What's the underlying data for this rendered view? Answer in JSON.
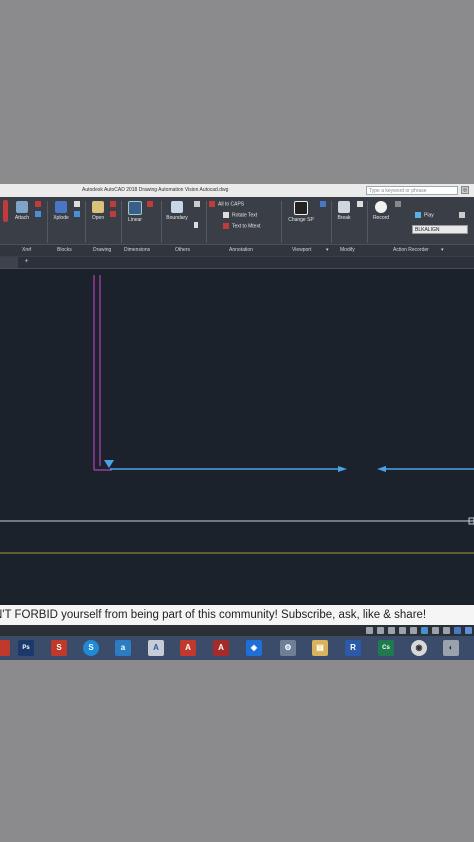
{
  "window": {
    "title": "Autodesk AutoCAD 2018   Drawing Automation Vision Autocad.dwg",
    "search_placeholder": "Type a keyword or phrase"
  },
  "ribbon": {
    "tools": {
      "attach": "Attach",
      "xplode": "Xplode",
      "open": "Open",
      "linear": "Linear",
      "boundary": "Boundary",
      "change_sp": "Change SP",
      "break": "Break",
      "record": "Record",
      "play": "Play"
    },
    "annotation_items": [
      "All to CAPS",
      "Rotate Text",
      "Text to Mtext"
    ],
    "action_dropdown": "BLKALIGN",
    "panels": [
      "Xref",
      "Blocks",
      "Drawing",
      "Dimensions",
      "Others",
      "Annotation",
      "Viewport",
      "Modify",
      "Action Recorder"
    ]
  },
  "banner": {
    "text": "N'T FORBID yourself from being part of this community! Subscribe, ask, like & share!"
  },
  "taskbar": {
    "apps": [
      {
        "name": "photoshop",
        "label": "Ps",
        "color": "#1b3a6b"
      },
      {
        "name": "sketchup",
        "label": "S",
        "color": "#c0392b"
      },
      {
        "name": "skype",
        "label": "S",
        "color": "#1f8ad6"
      },
      {
        "name": "autocad-app",
        "label": "a",
        "color": "#2b7cc0"
      },
      {
        "name": "autocad-lt",
        "label": "A",
        "color": "#c7ccd6"
      },
      {
        "name": "autocad-red",
        "label": "A",
        "color": "#c0392b"
      },
      {
        "name": "acrobat",
        "label": "A",
        "color": "#a52a2a"
      },
      {
        "name": "dropbox",
        "label": "◆",
        "color": "#1f6fd6"
      },
      {
        "name": "network",
        "label": "⚙",
        "color": "#6f7f95"
      },
      {
        "name": "file-explorer",
        "label": "▤",
        "color": "#d9b35c"
      },
      {
        "name": "revit",
        "label": "R",
        "color": "#2a5aa8"
      },
      {
        "name": "camtasia",
        "label": "Cs",
        "color": "#1f7a4d"
      },
      {
        "name": "chrome",
        "label": "◉",
        "color": "#d8d8d8"
      },
      {
        "name": "disk",
        "label": "◐",
        "color": "#9aa3ad"
      }
    ]
  }
}
